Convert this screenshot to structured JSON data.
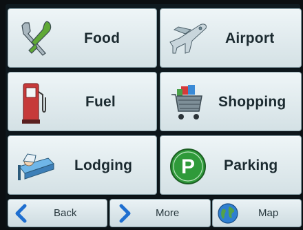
{
  "categories": [
    {
      "label": "Food",
      "icon": "fork-knife-icon"
    },
    {
      "label": "Airport",
      "icon": "airplane-icon"
    },
    {
      "label": "Fuel",
      "icon": "fuel-pump-icon"
    },
    {
      "label": "Shopping",
      "icon": "shopping-cart-icon"
    },
    {
      "label": "Lodging",
      "icon": "bed-icon"
    },
    {
      "label": "Parking",
      "icon": "parking-icon"
    }
  ],
  "bottom_bar": {
    "back_label": "Back",
    "more_label": "More",
    "map_label": "Map",
    "parking_glyph": "P"
  },
  "colors": {
    "button_face": "#e3edf0",
    "label_text": "#1b2a30",
    "arrow_blue": "#1f6fd0",
    "parking_green": "#2f9a3a"
  }
}
